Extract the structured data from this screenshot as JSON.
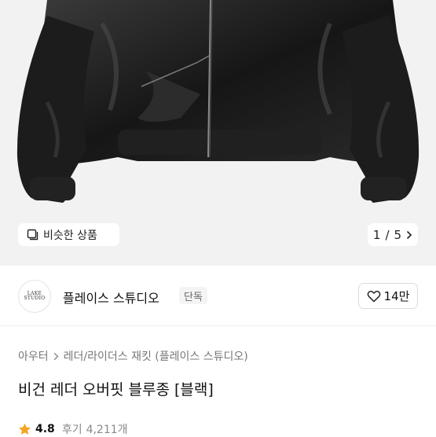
{
  "product_image": {
    "similar_button": {
      "label": "비슷한 상품",
      "icon": "similar-products-icon"
    },
    "pager": {
      "current": "1",
      "separator": "/",
      "total": "5",
      "icon": "chevron-right-icon"
    }
  },
  "brand": {
    "logo_text": "LAKE\nSTUDIO",
    "name": "플레이스 스튜디오",
    "badge": "단독",
    "like_count": "14만",
    "like_icon": "heart-outline-icon"
  },
  "breadcrumb": {
    "items": [
      "아우터",
      "레더/라이더스 재킷 (플레이스 스튜디오)"
    ],
    "separator_icon": "chevron-right-icon"
  },
  "product": {
    "title": "비건 레더 오버핏 블루종 [블랙]"
  },
  "rating": {
    "value": "4.8",
    "review_label": "후기",
    "review_count": "4,211개",
    "star_color": "#f5a623"
  }
}
